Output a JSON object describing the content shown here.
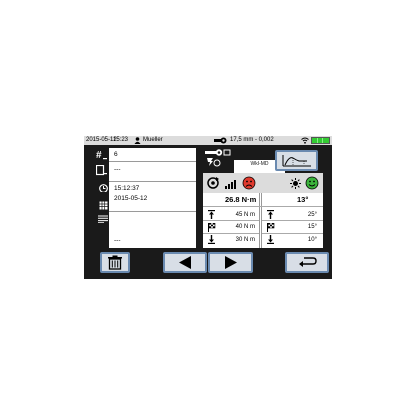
{
  "status_bar": {
    "date": "2015-05-12",
    "time": "15:23",
    "user": "Mueller",
    "tool_info": "17,5 mm - 0,002",
    "icons": [
      "user-icon",
      "wrench-icon",
      "wifi-icon",
      "battery-icon"
    ]
  },
  "info_panel": {
    "id_value": "6",
    "serial_value": "---",
    "time_value": "15:12:37",
    "date_value": "2015-05-12",
    "notes_value": "---"
  },
  "tool": {
    "name": "WkI-MD"
  },
  "result": {
    "torque": "26.8 N·m",
    "angle": "13°",
    "torque_limits": [
      "45 N m",
      "40 N m",
      "30 N m"
    ],
    "angle_limits": [
      "25°",
      "15°",
      "10°"
    ],
    "torque_status": "nok",
    "angle_status": "ok"
  },
  "colors": {
    "nok": "#e03a2e",
    "ok": "#3bb33b",
    "button_face": "#d8dee6",
    "button_border": "#6a8ab0",
    "battery": "#33cc33"
  }
}
